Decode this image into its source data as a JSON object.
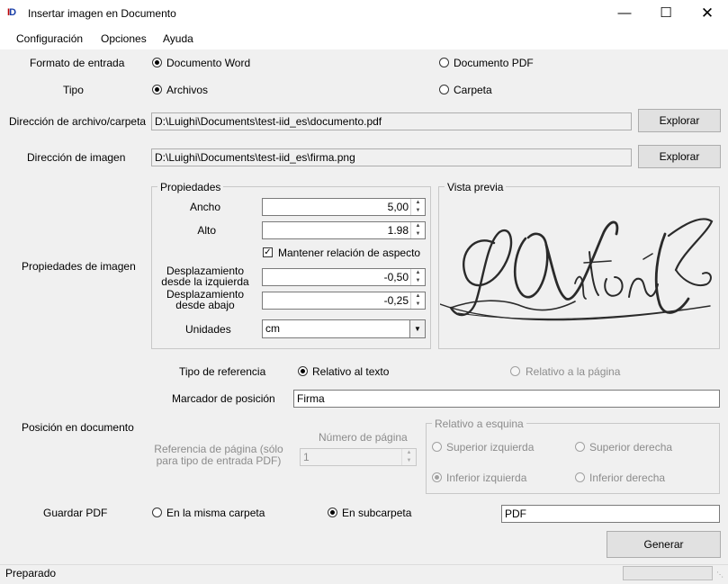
{
  "window": {
    "title": "Insertar imagen en Documento",
    "icon_text_a": "I",
    "icon_text_b": "D"
  },
  "menu": [
    "Configuración",
    "Opciones",
    "Ayuda"
  ],
  "input_format": {
    "label": "Formato de entrada",
    "option_word": "Documento Word",
    "option_pdf": "Documento PDF",
    "selected": "Documento Word"
  },
  "type": {
    "label": "Tipo",
    "option_files": "Archivos",
    "option_folder": "Carpeta",
    "selected": "Archivos"
  },
  "file_path": {
    "label": "Dirección de archivo/carpeta",
    "value": "D:\\Luighi\\Documents\\test-iid_es\\documento.pdf",
    "browse": "Explorar"
  },
  "image_path": {
    "label": "Dirección de imagen",
    "value": "D:\\Luighi\\Documents\\test-iid_es\\firma.png",
    "browse": "Explorar"
  },
  "image_props": {
    "section_label": "Propiedades de imagen",
    "group_title": "Propiedades",
    "width_label": "Ancho",
    "width_value": "5,00",
    "height_label": "Alto",
    "height_value": "1.98",
    "keep_aspect_label": "Mantener relación de aspecto",
    "keep_aspect_checked": true,
    "offset_left_label_1": "Desplazamiento",
    "offset_left_label_2": "desde la izquierda",
    "offset_left_value": "-0,50",
    "offset_bottom_label_1": "Desplazamiento",
    "offset_bottom_label_2": "desde abajo",
    "offset_bottom_value": "-0,25",
    "units_label": "Unidades",
    "units_value": "cm"
  },
  "preview": {
    "title": "Vista previa"
  },
  "position": {
    "section_label": "Posición en documento",
    "ref_type_label": "Tipo de referencia",
    "ref_text": "Relativo al texto",
    "ref_page": "Relativo a la página",
    "ref_selected": "Relativo al texto",
    "marker_label": "Marcador de posición",
    "marker_value": "Firma",
    "page_ref_label_1": "Referencia de página (sólo",
    "page_ref_label_2": "para tipo de entrada PDF)",
    "page_number_label": "Número de página",
    "page_number_value": "1",
    "corner_group_title": "Relativo a esquina",
    "corner_tl": "Superior izquierda",
    "corner_tr": "Superior derecha",
    "corner_bl": "Inferior izquierda",
    "corner_br": "Inferior derecha",
    "corner_selected": "Inferior izquierda"
  },
  "save_pdf": {
    "label": "Guardar PDF",
    "option_same": "En la misma carpeta",
    "option_sub": "En subcarpeta",
    "selected": "En subcarpeta",
    "subfolder_value": "PDF"
  },
  "generate_button": "Generar",
  "status": "Preparado"
}
